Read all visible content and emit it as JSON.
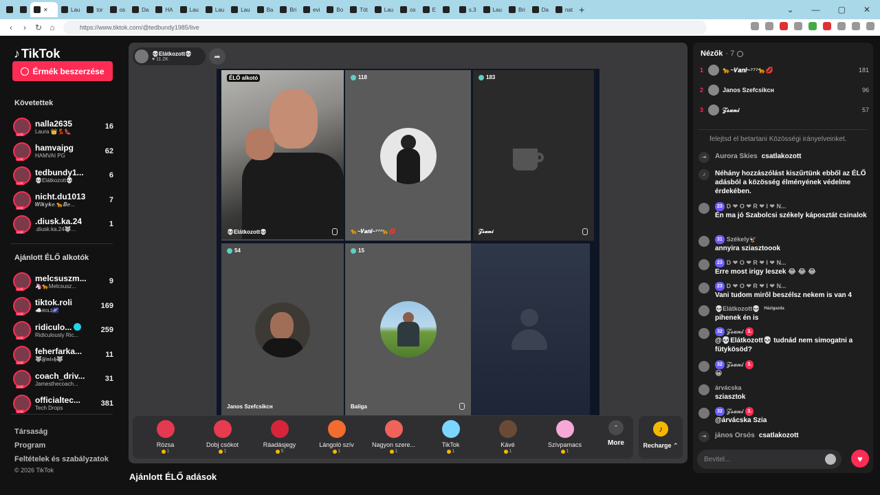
{
  "browser": {
    "tabs": [
      "Lau",
      "tor",
      "os",
      "Da",
      "HA",
      "Lau",
      "Lau",
      "Lau",
      "Ba",
      "Bri",
      "evi",
      "Bo",
      "Tót",
      "Lau",
      "os",
      "E",
      "",
      "s.3",
      "Lau",
      "Bri",
      "Da",
      "nat"
    ],
    "url": "https://www.tiktok.com/@tedbundy1985/live"
  },
  "sidebar": {
    "logo": "TikTok",
    "coins_button": "Érmék beszerzése",
    "following_header": "Követettek",
    "following": [
      {
        "name": "nalla2635",
        "sub": "Laura 👑💃👠",
        "count": "16"
      },
      {
        "name": "hamvaipg",
        "sub": "HAMVAI PG",
        "count": "62"
      },
      {
        "name": "tedbundy1...",
        "sub": "💀Elátkozott💀",
        "count": "6"
      },
      {
        "name": "nicht.du1013",
        "sub": "𝑾𝒊𝒌𝒚𝒌𝒆.🐆𝑩𝒆...",
        "count": "7"
      },
      {
        "name": ".diusk.ka.24",
        "sub": ".diusk.ka.24🐺...",
        "count": "1"
      }
    ],
    "recommended_header": "Ajánlott ÉLŐ alkotók",
    "recommended": [
      {
        "name": "melcsuszm...",
        "sub": "🦄🐆Melcsusz...",
        "count": "9",
        "verified": false
      },
      {
        "name": "tiktok.roli",
        "sub": "☁️ʀᴏʟɪ🌌",
        "count": "169",
        "verified": false
      },
      {
        "name": "ridiculo...",
        "sub": "Ridiculously Ric...",
        "count": "259",
        "verified": true
      },
      {
        "name": "feherfarka...",
        "sub": "🐺𝕱𝖎𝖓𝖎𝖘𝖍🐺",
        "count": "11",
        "verified": false
      },
      {
        "name": "coach_driv...",
        "sub": "Jamesthecoach...",
        "count": "31",
        "verified": false
      },
      {
        "name": "officialtec...",
        "sub": "Tech Drops",
        "count": "381",
        "verified": false
      }
    ],
    "links": [
      "Társaság",
      "Program",
      "Feltételek és szabályzatok"
    ],
    "copyright": "© 2026 TikTok"
  },
  "live": {
    "host_name": "💀Elátkozott💀",
    "host_likes": "11.2K",
    "host_label": "ÉLŐ alkotó",
    "cells": [
      {
        "score": "",
        "name": "💀Elátkozott💀"
      },
      {
        "score": "118",
        "name": "🐆~𝑽𝒂𝒏𝒊~⁷⁷⁷🐆💋"
      },
      {
        "score": "183",
        "name": "𝓩𝓼𝓪𝓷𝓲"
      },
      {
        "score": "54",
        "name": "Janos Szefcsikᴄʜ"
      },
      {
        "score": "15",
        "name": "Baliga"
      }
    ],
    "gifts": [
      {
        "label": "Rózsa",
        "price": "1",
        "color": "#e53950"
      },
      {
        "label": "Dobj csókot",
        "price": "1",
        "color": "#e83b4f"
      },
      {
        "label": "Ráadásjegy",
        "price": "5",
        "color": "#d6243a"
      },
      {
        "label": "Lángoló szív",
        "price": "1",
        "color": "#f26b2f"
      },
      {
        "label": "Nagyon szere...",
        "price": "1",
        "color": "#f0635a"
      },
      {
        "label": "TikTok",
        "price": "1",
        "color": "#7bd7ff"
      },
      {
        "label": "Kávé",
        "price": "1",
        "color": "#6b4a35"
      },
      {
        "label": "Szívpamacs",
        "price": "1",
        "color": "#f7a8d6"
      }
    ],
    "more_label": "More",
    "recharge_label": "Recharge ⌃",
    "recommended_title": "Ajánlott ÉLŐ adások"
  },
  "chat": {
    "viewers_label": "Nézők",
    "viewers_count": "· 7",
    "top_viewers": [
      {
        "rank": "1",
        "name": "🐆~𝑽𝒂𝒏𝒊~⁷⁷⁷🐆💋",
        "score": "181",
        "rank_color": "#fe2c55"
      },
      {
        "rank": "2",
        "name": "Janos Szefcsikᴄʜ",
        "score": "96",
        "rank_color": "#fe2c55"
      },
      {
        "rank": "3",
        "name": "𝓩𝓼𝓪𝓷𝓲",
        "score": "57",
        "rank_color": "#fe2c55"
      }
    ],
    "messages": [
      {
        "user": "",
        "text": "felejtsd el betartani Közösségi irányelveinket."
      },
      {
        "user": "Aurora Skies",
        "text": "csatlakozott"
      },
      {
        "user": "",
        "text": "Néhány hozzászólást kiszűrtünk ebből az ÉLŐ adásból a közösség élményének védelme érdekében."
      },
      {
        "user": "D ❤ O ❤ R ❤ I ❤ N...",
        "level": "23",
        "text": "Én ma jó Szabolcsi székely káposztát csinalok"
      },
      {
        "user": "Székely🦅",
        "level": "31",
        "text": "annyira sziasztoook"
      },
      {
        "user": "D ❤ O ❤ R ❤ I ❤ N...",
        "level": "23",
        "text": "Erre most irigy leszek 😂 😂 😂"
      },
      {
        "user": "D ❤ O ❤ R ❤ I ❤ N...",
        "level": "23",
        "text": "Vani tudom miről beszélsz nekem is van 4"
      },
      {
        "user": "💀Elátkozott💀",
        "badge": "Házigazda",
        "text": "pihenek én is"
      },
      {
        "user": "𝓩𝓼𝓪𝓷𝓲",
        "level": "32",
        "tag": "3.",
        "text": "@💀Elátkozott💀 tudnád nem simogatni a fütykösöd?"
      },
      {
        "user": "𝓩𝓼𝓪𝓷𝓲",
        "level": "32",
        "tag": "3.",
        "text": "😀"
      },
      {
        "user": "árvácska",
        "text": "sziasztok"
      },
      {
        "user": "𝓩𝓼𝓪𝓷𝓲",
        "level": "32",
        "tag": "3.",
        "text": "@árvácska Szia"
      },
      {
        "user": "jános Orsós",
        "text": "csatlakozott"
      }
    ],
    "input_placeholder": "Bevitel..."
  }
}
